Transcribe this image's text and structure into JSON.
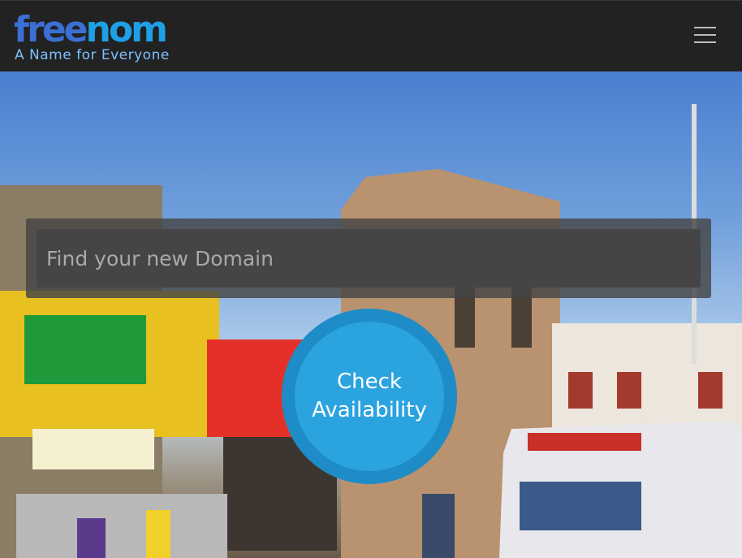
{
  "header": {
    "logo_free": "free",
    "logo_nom": "nom",
    "tagline": "A Name for Everyone",
    "menu_icon": "hamburger-menu-icon"
  },
  "search": {
    "placeholder": "Find your new Domain",
    "value": ""
  },
  "check_button": {
    "line1": "Check",
    "line2": "Availability"
  },
  "colors": {
    "header_bg": "#222222",
    "logo_free": "#3b6fd3",
    "logo_nom": "#1ea0e6",
    "tagline": "#7cc1ff",
    "button": "#2ba3de",
    "button_ring": "#1e8cc6"
  }
}
